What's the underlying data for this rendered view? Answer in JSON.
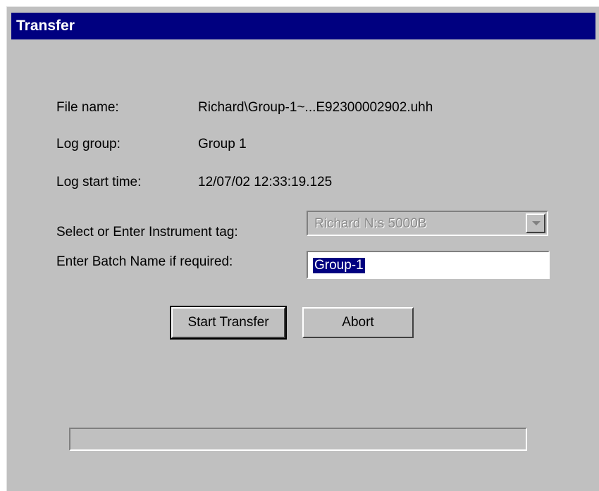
{
  "window": {
    "title": "Transfer"
  },
  "info": {
    "file_name_label": "File name:",
    "file_name_value": "Richard\\Group-1~...E92300002902.uhh",
    "log_group_label": "Log group:",
    "log_group_value": "Group 1",
    "log_start_label": "Log start time:",
    "log_start_value": "12/07/02 12:33:19.125"
  },
  "form": {
    "instrument_label": "Select or Enter Instrument tag:",
    "instrument_value": "Richard N:s 5000B",
    "instrument_enabled": false,
    "batch_label": "Enter Batch Name if required:",
    "batch_value": "Group-1",
    "batch_selected": true
  },
  "buttons": {
    "start_label": "Start Transfer",
    "abort_label": "Abort"
  },
  "progress": {
    "percent": 0
  },
  "colors": {
    "titlebar": "#000080",
    "face": "#c0c0c0",
    "selection": "#000080"
  }
}
